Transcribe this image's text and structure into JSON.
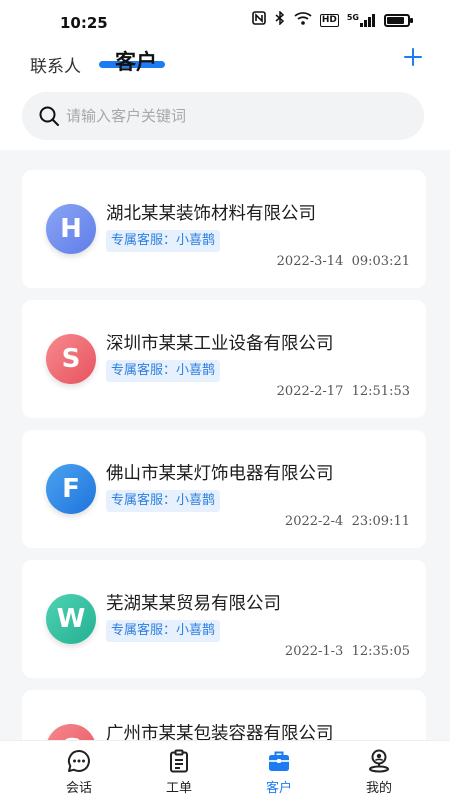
{
  "status_bar": {
    "time": "10:25",
    "icons": [
      "nfc-icon",
      "bluetooth-icon",
      "wifi-icon",
      "hd-icon",
      "signal-5g-icon",
      "battery-icon"
    ],
    "hd_text": "HD",
    "network_text": "5G"
  },
  "header": {
    "tabs": [
      {
        "label": "联系人",
        "active": false
      },
      {
        "label": "客户",
        "active": true
      }
    ],
    "add_icon": "plus-icon",
    "accent_color": "#1d7cf2"
  },
  "search": {
    "placeholder": "请输入客户关键词",
    "value": ""
  },
  "customers": [
    {
      "initial": "H",
      "name": "湖北某某装饰材料有限公司",
      "tag": "专属客服：小喜鹊",
      "date": "2022-3-14",
      "time": "09:03:21",
      "color": "#6f8ef0"
    },
    {
      "initial": "S",
      "name": "深圳市某某工业设备有限公司",
      "tag": "专属客服：小喜鹊",
      "date": "2022-2-17",
      "time": "12:51:53",
      "color": "#ef6470"
    },
    {
      "initial": "F",
      "name": "佛山市某某灯饰电器有限公司",
      "tag": "专属客服：小喜鹊",
      "date": "2022-2-4",
      "time": "23:09:11",
      "color": "#2f8ae8"
    },
    {
      "initial": "W",
      "name": "芜湖某某贸易有限公司",
      "tag": "专属客服：小喜鹊",
      "date": "2022-1-3",
      "time": "12:35:05",
      "color": "#37c2a3"
    },
    {
      "initial": "G",
      "name": "广州市某某包装容器有限公司",
      "tag": "",
      "date": "",
      "time": "",
      "color": "#ef6470"
    }
  ],
  "bottom_nav": [
    {
      "label": "会话",
      "icon": "chat-bubble-icon",
      "active": false
    },
    {
      "label": "工单",
      "icon": "clipboard-icon",
      "active": false
    },
    {
      "label": "客户",
      "icon": "briefcase-icon",
      "active": true
    },
    {
      "label": "我的",
      "icon": "person-pin-icon",
      "active": false
    }
  ]
}
